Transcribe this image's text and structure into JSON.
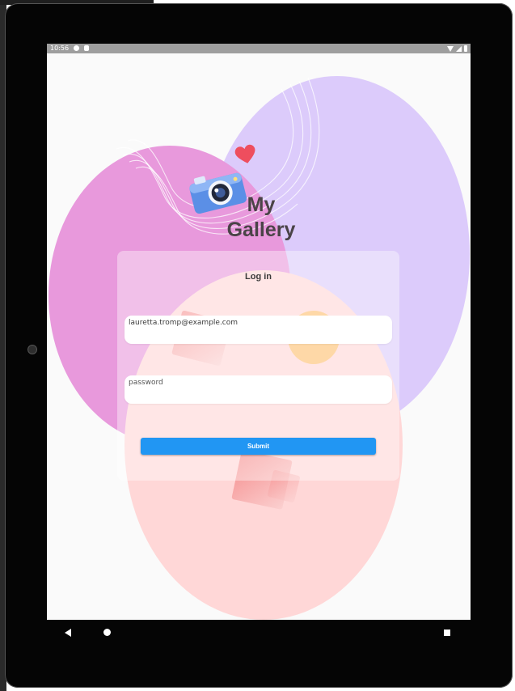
{
  "status_bar": {
    "time": "10:56",
    "icons": [
      "notification-icon",
      "sd-card-icon",
      "wifi-icon",
      "signal-icon",
      "battery-icon"
    ]
  },
  "app": {
    "title_line1": "My",
    "title_line2": "Gallery",
    "decorations": [
      "camera-icon",
      "heart-icon"
    ]
  },
  "login": {
    "heading": "Log in",
    "email_value": "lauretta.tromp@example.com",
    "password_placeholder": "password",
    "submit_label": "Submit"
  },
  "nav_bar": {
    "buttons": [
      "back-icon",
      "home-icon",
      "recent-apps-icon"
    ]
  },
  "colors": {
    "accent": "#2196f3",
    "blob_purple": "#dccbfb",
    "blob_magenta": "#e899dc",
    "blob_pink": "#ffd7d7",
    "sun": "#fdc072"
  }
}
